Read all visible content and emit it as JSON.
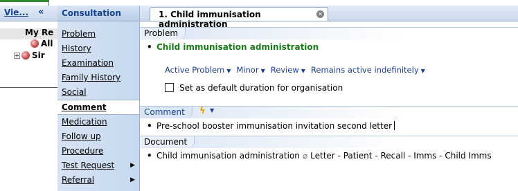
{
  "view_panel": {
    "header": "Vie...",
    "collapse": "«",
    "row1": "My Re",
    "row2": "All",
    "row3": "Sir"
  },
  "menu": {
    "header": "Consultation",
    "items": [
      {
        "label": "Problem"
      },
      {
        "label": "History"
      },
      {
        "label": "Examination"
      },
      {
        "label": "Family History"
      },
      {
        "label": "Social"
      },
      {
        "label": "Comment"
      },
      {
        "label": "Medication"
      },
      {
        "label": "Follow up"
      },
      {
        "label": "Procedure"
      },
      {
        "label": "Test Request"
      },
      {
        "label": "Referral"
      }
    ]
  },
  "tab": {
    "label": "1. Child immunisation administration"
  },
  "sections": {
    "problem": {
      "caption": "Problem",
      "title": "Child immunisation administration",
      "status": "Active Problem",
      "severity": "Minor",
      "review": "Review",
      "duration": "Remains active indefinitely",
      "checkbox_label": "Set as default duration for organisation",
      "checkbox_checked": false
    },
    "comment": {
      "caption": "Comment",
      "text": "Pre-school booster immunisation invitation second letter"
    },
    "document": {
      "caption": "Document",
      "title": "Child immunisation administration",
      "detail": "Letter - Patient - Recall - Imms - Child Imms"
    }
  },
  "colors": {
    "accent": "#15428b",
    "problem_green": "#1a7a1a",
    "meta_blue": "#1f3d8a",
    "menu_bg": "#c7d9f0"
  }
}
